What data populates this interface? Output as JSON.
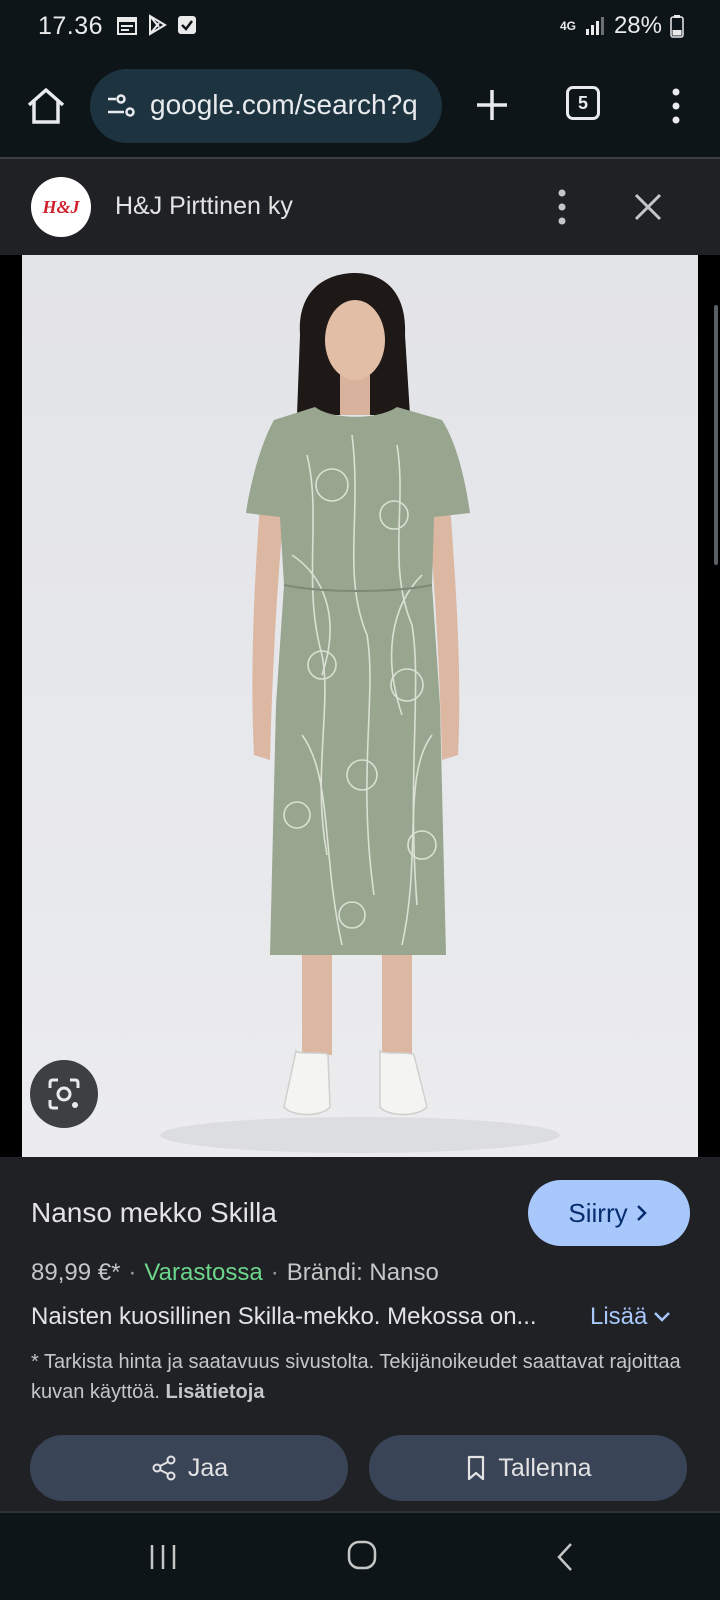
{
  "status_bar": {
    "time": "17.36",
    "network": "4G",
    "battery": "28%"
  },
  "browser": {
    "url": "google.com/search?q",
    "tab_count": "5"
  },
  "viewer": {
    "merchant_logo_text": "H&J",
    "merchant_name": "H&J Pirttinen ky"
  },
  "product": {
    "title": "Nanso mekko Skilla",
    "go_label": "Siirry",
    "price": "89,99 €*",
    "stock": "Varastossa",
    "brand": "Brändi: Nanso",
    "description": "Naisten kuosillinen Skilla-mekko. Mekossa on...",
    "more_label": "Lisää",
    "disclaimer": "* Tarkista hinta ja saatavuus sivustolta. Tekijänoikeudet saattavat rajoittaa kuvan käyttöä.",
    "more_info_label": "Lisätietoja",
    "share_label": "Jaa",
    "save_label": "Tallenna"
  },
  "colors": {
    "accent": "#a8c7fa",
    "in_stock": "#6dd58c",
    "dress": "#98a58f"
  },
  "icons": [
    "calendar-icon",
    "play-store-icon",
    "check-icon",
    "signal-icon",
    "battery-icon",
    "home-icon",
    "tune-icon",
    "plus-icon",
    "more-vert-icon",
    "close-icon",
    "lens-icon",
    "chevron-right-icon",
    "chevron-down-icon",
    "share-icon",
    "bookmark-icon"
  ]
}
